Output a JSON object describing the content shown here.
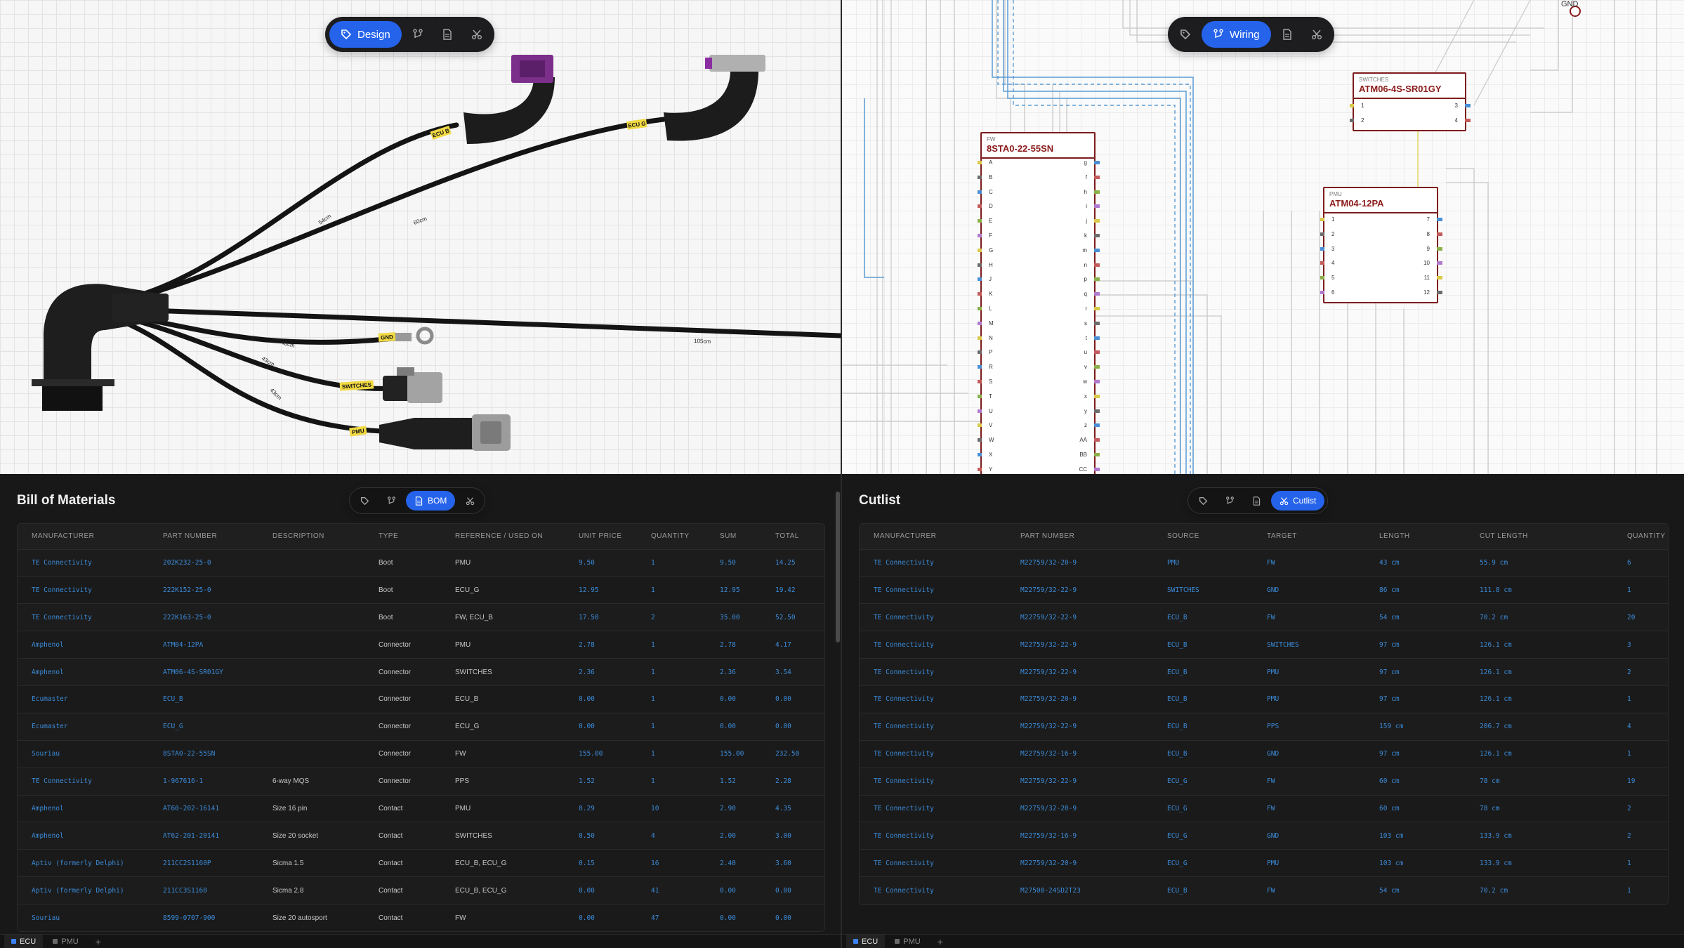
{
  "design_toolbar": {
    "active_label": "Design"
  },
  "wiring_toolbar": {
    "active_label": "Wiring"
  },
  "bom_toolbar": {
    "active_label": "BOM"
  },
  "cutlist_toolbar": {
    "active_label": "Cutlist"
  },
  "harness": {
    "labels": {
      "ecu_b": "ECU B",
      "ecu_g": "ECU G",
      "gnd": "GND",
      "switches": "SWITCHES",
      "pmu": "PMU"
    },
    "lengths": {
      "l54": "54cm",
      "l60": "60cm",
      "l43a": "43cm",
      "l43b": "43cm",
      "l43c": "43cm",
      "l105": "105cm"
    }
  },
  "schematic": {
    "gnd_label": "GND",
    "switches": {
      "type": "SWITCHES",
      "name": "ATM06-4S-SR01GY",
      "left_pins": [
        "1",
        "2"
      ],
      "right_pins": [
        "3",
        "4"
      ]
    },
    "pmu": {
      "type": "PMU",
      "name": "ATM04-12PA",
      "left_pins": [
        "1",
        "2",
        "3",
        "4",
        "5",
        "6"
      ],
      "right_pins": [
        "7",
        "8",
        "9",
        "10",
        "11",
        "12"
      ]
    },
    "fw": {
      "type": "FW",
      "name": "8STA0-22-55SN",
      "left_pins": [
        "A",
        "B",
        "C",
        "D",
        "E",
        "F",
        "G",
        "H",
        "J",
        "K",
        "L",
        "M",
        "N",
        "P",
        "R",
        "S",
        "T",
        "U",
        "V",
        "W",
        "X",
        "Y"
      ],
      "right_pins": [
        "g",
        "f",
        "h",
        "i",
        "j",
        "k",
        "m",
        "n",
        "p",
        "q",
        "r",
        "s",
        "t",
        "u",
        "v",
        "w",
        "x",
        "y",
        "z",
        "AA",
        "BB",
        "CC"
      ]
    }
  },
  "bom": {
    "title": "Bill of Materials",
    "columns": [
      "MANUFACTURER",
      "PART NUMBER",
      "DESCRIPTION",
      "TYPE",
      "REFERENCE / USED ON",
      "UNIT PRICE",
      "QUANTITY",
      "SUM",
      "TOTAL"
    ],
    "rows": [
      [
        "TE Connectivity",
        "202K232-25-0",
        "",
        "Boot",
        "PMU",
        "9.50",
        "1",
        "9.50",
        "14.25"
      ],
      [
        "TE Connectivity",
        "222K152-25-0",
        "",
        "Boot",
        "ECU_G",
        "12.95",
        "1",
        "12.95",
        "19.42"
      ],
      [
        "TE Connectivity",
        "222K163-25-0",
        "",
        "Boot",
        "FW, ECU_B",
        "17.50",
        "2",
        "35.00",
        "52.50"
      ],
      [
        "Amphenol",
        "ATM04-12PA",
        "",
        "Connector",
        "PMU",
        "2.78",
        "1",
        "2.78",
        "4.17"
      ],
      [
        "Amphenol",
        "ATM06-4S-SR01GY",
        "",
        "Connector",
        "SWITCHES",
        "2.36",
        "1",
        "2.36",
        "3.54"
      ],
      [
        "Ecumaster",
        "ECU_B",
        "",
        "Connector",
        "ECU_B",
        "0.00",
        "1",
        "0.00",
        "0.00"
      ],
      [
        "Ecumaster",
        "ECU_G",
        "",
        "Connector",
        "ECU_G",
        "0.00",
        "1",
        "0.00",
        "0.00"
      ],
      [
        "Souriau",
        "8STA0-22-55SN",
        "",
        "Connector",
        "FW",
        "155.00",
        "1",
        "155.00",
        "232.50"
      ],
      [
        "TE Connectivity",
        "1-967616-1",
        "6-way MQS",
        "Connector",
        "PPS",
        "1.52",
        "1",
        "1.52",
        "2.28"
      ],
      [
        "Amphenol",
        "AT60-202-16141",
        "Size 16 pin",
        "Contact",
        "PMU",
        "0.29",
        "10",
        "2.90",
        "4.35"
      ],
      [
        "Amphenol",
        "AT62-201-20141",
        "Size 20 socket",
        "Contact",
        "SWITCHES",
        "0.50",
        "4",
        "2.00",
        "3.00"
      ],
      [
        "Aptiv (formerly Delphi)",
        "211CC2S1160P",
        "Sicma 1.5",
        "Contact",
        "ECU_B, ECU_G",
        "0.15",
        "16",
        "2.40",
        "3.60"
      ],
      [
        "Aptiv (formerly Delphi)",
        "211CC3S1160",
        "Sicma 2.8",
        "Contact",
        "ECU_B, ECU_G",
        "0.00",
        "41",
        "0.00",
        "0.00"
      ],
      [
        "Souriau",
        "8599-0707-900",
        "Size 20 autosport",
        "Contact",
        "FW",
        "0.00",
        "47",
        "0.00",
        "0.00"
      ]
    ]
  },
  "cutlist": {
    "title": "Cutlist",
    "columns": [
      "MANUFACTURER",
      "PART NUMBER",
      "SOURCE",
      "TARGET",
      "LENGTH",
      "CUT LENGTH",
      "QUANTITY"
    ],
    "rows": [
      [
        "TE Connectivity",
        "M22759/32-20-9",
        "PMU",
        "FW",
        "43 cm",
        "55.9 cm",
        "6"
      ],
      [
        "TE Connectivity",
        "M22759/32-22-9",
        "SWITCHES",
        "GND",
        "86 cm",
        "111.8 cm",
        "1"
      ],
      [
        "TE Connectivity",
        "M22759/32-22-9",
        "ECU_B",
        "FW",
        "54 cm",
        "70.2 cm",
        "20"
      ],
      [
        "TE Connectivity",
        "M22759/32-22-9",
        "ECU_B",
        "SWITCHES",
        "97 cm",
        "126.1 cm",
        "3"
      ],
      [
        "TE Connectivity",
        "M22759/32-22-9",
        "ECU_B",
        "PMU",
        "97 cm",
        "126.1 cm",
        "2"
      ],
      [
        "TE Connectivity",
        "M22759/32-20-9",
        "ECU_B",
        "PMU",
        "97 cm",
        "126.1 cm",
        "1"
      ],
      [
        "TE Connectivity",
        "M22759/32-22-9",
        "ECU_B",
        "PPS",
        "159 cm",
        "206.7 cm",
        "4"
      ],
      [
        "TE Connectivity",
        "M22759/32-16-9",
        "ECU_B",
        "GND",
        "97 cm",
        "126.1 cm",
        "1"
      ],
      [
        "TE Connectivity",
        "M22759/32-22-9",
        "ECU_G",
        "FW",
        "60 cm",
        "78 cm",
        "19"
      ],
      [
        "TE Connectivity",
        "M22759/32-20-9",
        "ECU_G",
        "FW",
        "60 cm",
        "78 cm",
        "2"
      ],
      [
        "TE Connectivity",
        "M22759/32-16-9",
        "ECU_G",
        "GND",
        "103 cm",
        "133.9 cm",
        "2"
      ],
      [
        "TE Connectivity",
        "M22759/32-20-9",
        "ECU_G",
        "PMU",
        "103 cm",
        "133.9 cm",
        "1"
      ],
      [
        "TE Connectivity",
        "M27500-24SD2T23",
        "ECU_B",
        "FW",
        "54 cm",
        "70.2 cm",
        "1"
      ]
    ]
  },
  "tabs": {
    "left": [
      "ECU",
      "PMU"
    ],
    "right": [
      "ECU",
      "PMU"
    ],
    "add": "+"
  }
}
